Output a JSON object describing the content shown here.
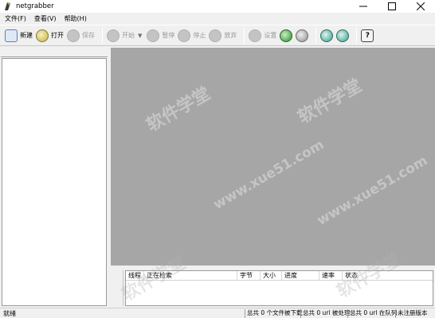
{
  "window": {
    "title": "netgrabber"
  },
  "menu": [
    {
      "label": "文件(F)"
    },
    {
      "label": "查看(V)"
    },
    {
      "label": "帮助(H)"
    }
  ],
  "toolbar": {
    "new_label": "新建",
    "open_label": "打开",
    "save_label": "保存",
    "start_label": "开始",
    "pause_label": "暂停",
    "stop_label": "停止",
    "discard_label": "放弃",
    "settings_label": "设置"
  },
  "table": {
    "columns": [
      "线程",
      "正在检索",
      "字节",
      "大小",
      "进度",
      "速率",
      "状态"
    ]
  },
  "status": {
    "ready": "就绪",
    "files_downloaded": "总共 0 个文件被下载",
    "urls_processed": "总共 0 url 被处理",
    "urls_queued": "总共 0 url 在队列",
    "unregistered": "未注册版本"
  },
  "watermark": {
    "text_cn": "软件学堂",
    "text_url": "www.xue51.com"
  },
  "colors": {
    "main_view_bg": "#a6a6a6",
    "panel_bg": "#ffffff",
    "chrome_bg": "#f0f0f0"
  }
}
